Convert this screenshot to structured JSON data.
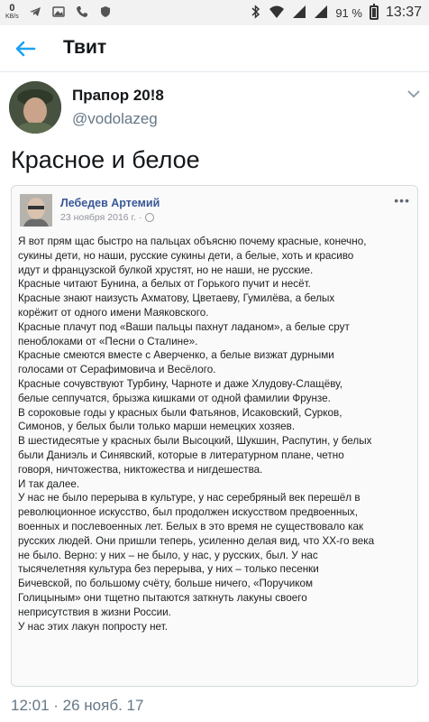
{
  "status_bar": {
    "speed_value": "0",
    "speed_unit": "KB/s",
    "battery_percent": "91 %",
    "time": "13:37",
    "icons": [
      "telegram-icon",
      "image-icon",
      "phone-icon",
      "shield-icon",
      "bluetooth-icon",
      "wifi-icon",
      "signal-icon",
      "signal-icon",
      "battery-icon"
    ]
  },
  "app_bar": {
    "title": "Твит",
    "back_icon": "arrow-left-icon"
  },
  "tweet": {
    "author_name": "Прапор 20!8",
    "author_handle": "@vodolazeg",
    "text": "Красное и белое",
    "timestamp": "12:01 · 26 нояб. 17"
  },
  "embedded_post": {
    "author": "Лебедев Артемий",
    "date": "23 ноября 2016 г. ·",
    "lines": [
      "Я вот прям щас быстро на пальцах объясню почему красные, конечно,",
      "сукины дети, но наши, русские сукины дети, а белые, хоть и красиво",
      "идут и французской булкой хрустят, но не наши, не русские.",
      "Красные читают Бунина, а белых от Горького пучит и несёт.",
      "Красные знают наизусть Ахматову, Цветаеву, Гумилёва, а белых",
      "корёжит от одного имени Маяковского.",
      "Красные плачут под «Ваши пальцы пахнут ладаном», а белые срут",
      "пеноблоками от «Песни о Сталине».",
      "Красные смеются вместе с Аверченко, а белые визжат дурными",
      "голосами от Серафимовича и Весёлого.",
      "Красные сочувствуют Турбину, Чарноте и даже Хлудову-Слащёву,",
      "белые сеппучатся, брызжа кишками от одной фамилии Фрунзе.",
      "В сороковые годы у красных были Фатьянов, Исаковский, Сурков,",
      "Симонов, у белых были только марши немецких хозяев.",
      "В шестидесятые у красных были Высоцкий, Шукшин, Распутин, у белых",
      "были Даниэль и Синявский, которые в литературном плане, четно",
      "говоря, ничтожества, никтожества и нигдешества.",
      "И так далее.",
      "У нас не было перерыва в культуре, у нас серебряный век перешёл в",
      "революционное искусство, был продолжен искусством предвоенных,",
      "военных и послевоенных лет. Белых в это время не существовало как",
      "русских людей. Они пришли теперь, усиленно делая вид, что XX-го века",
      "не было. Верно: у них – не было, у нас, у русских, был. У нас",
      "тысячелетняя культура без перерыва, у них – только песенки",
      "Бичевской, по большому счёту, больше ничего, «Поручиком",
      "Голицыным» они тщетно пытаются заткнуть лакуны своего",
      "неприсутствия в жизни России.",
      "У нас этих лакун попросту нет."
    ]
  },
  "colors": {
    "accent": "#1da1f2",
    "secondary_text": "#657786",
    "fb_link": "#385898"
  }
}
